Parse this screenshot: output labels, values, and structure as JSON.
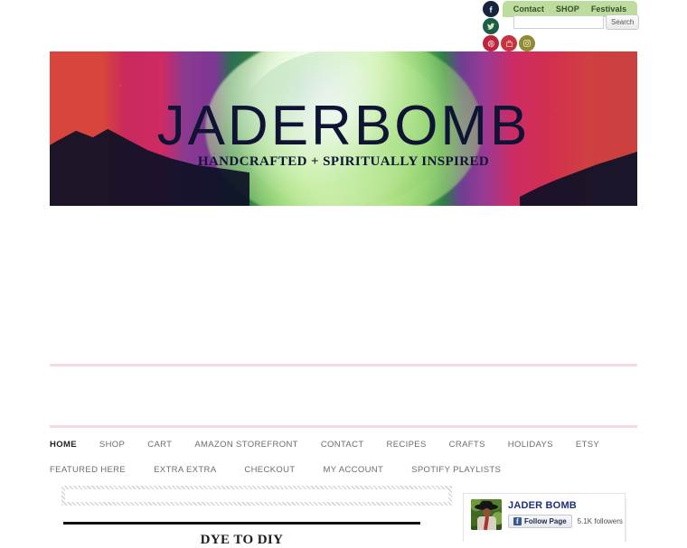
{
  "topbar": {
    "social_icons": [
      {
        "name": "facebook-icon",
        "label": "f",
        "color": "#16243f"
      },
      {
        "name": "twitter-icon",
        "label": "t",
        "color": "#1d5c4a"
      },
      {
        "name": "pinterest-icon",
        "label": "P",
        "color": "#c0243c"
      },
      {
        "name": "shop-icon",
        "label": "",
        "color": "#c73440"
      },
      {
        "name": "instagram-icon",
        "label": "",
        "color": "#8f8a36"
      }
    ],
    "nav": [
      {
        "label": "Contact"
      },
      {
        "label": "SHOP"
      },
      {
        "label": "Festivals"
      }
    ],
    "nav_background": "#bcdd9d",
    "search": {
      "value": "",
      "placeholder": "",
      "button_label": "Search"
    }
  },
  "banner": {
    "title": "JADERBOMB",
    "subtitle": "HANDCRAFTED + SPIRITUALLY INSPIRED",
    "text_color": "#101434"
  },
  "menu": {
    "row1": [
      {
        "label": "HOME",
        "active": true
      },
      {
        "label": "SHOP",
        "active": false
      },
      {
        "label": "CART",
        "active": false
      },
      {
        "label": "AMAZON STOREFRONT",
        "active": false
      },
      {
        "label": "CONTACT",
        "active": false
      },
      {
        "label": "RECIPES",
        "active": false
      },
      {
        "label": "CRAFTS",
        "active": false
      },
      {
        "label": "HOLIDAYS",
        "active": false
      },
      {
        "label": "ETSY",
        "active": false
      }
    ],
    "row2": [
      {
        "label": "FEATURED HERE"
      },
      {
        "label": "EXTRA EXTRA"
      },
      {
        "label": "CHECKOUT"
      },
      {
        "label": "MY ACCOUNT"
      },
      {
        "label": "SPOTIFY PLAYLISTS"
      }
    ]
  },
  "facebook_widget": {
    "page_name": "JADER BOMB",
    "follow_label": "Follow Page",
    "follow_icon": "f",
    "followers": "5.1K followers"
  },
  "post": {
    "title": "DYE TO DIY"
  },
  "colors": {
    "divider_pink": "#f9d9dd",
    "accent_green": "#bcdd9d",
    "fb_blue": "#1d2e7a"
  }
}
